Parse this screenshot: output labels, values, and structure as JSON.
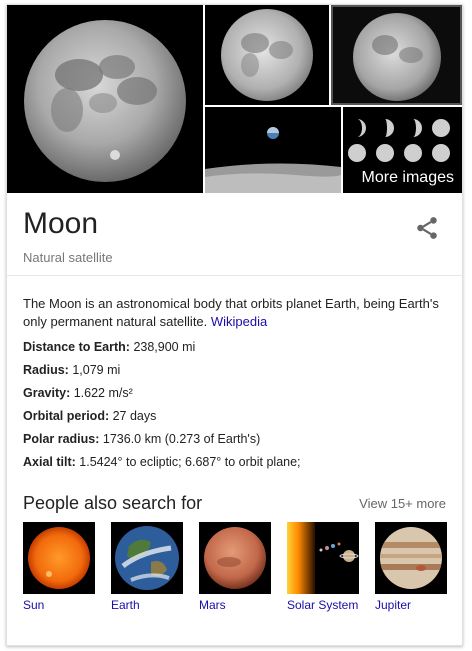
{
  "images": {
    "more_label": "More images",
    "main_alt": "moon-full-image",
    "items": [
      "moon-full",
      "moon-full-2",
      "moon-full-3",
      "earthrise",
      "moon-phases"
    ]
  },
  "entity": {
    "title": "Moon",
    "subtitle": "Natural satellite",
    "share_icon": "share-icon"
  },
  "description": {
    "text": "The Moon is an astronomical body that orbits planet Earth, being Earth's only permanent natural satellite. ",
    "link": "Wikipedia"
  },
  "facts": [
    {
      "label": "Distance to Earth:",
      "value": " 238,900 mi"
    },
    {
      "label": "Radius:",
      "value": " 1,079 mi"
    },
    {
      "label": "Gravity:",
      "value": " 1.622 m/s²"
    },
    {
      "label": "Orbital period:",
      "value": " 27 days"
    },
    {
      "label": "Polar radius:",
      "value": " 1736.0 km (0.273 of Earth's)"
    },
    {
      "label": "Axial tilt:",
      "value": " 1.5424° to ecliptic; 6.687° to orbit plane;"
    }
  ],
  "people_also_search": {
    "title": "People also search for",
    "more": "View 15+ more",
    "items": [
      {
        "label": "Sun"
      },
      {
        "label": "Earth"
      },
      {
        "label": "Mars"
      },
      {
        "label": "Solar System"
      },
      {
        "label": "Jupiter"
      }
    ]
  }
}
